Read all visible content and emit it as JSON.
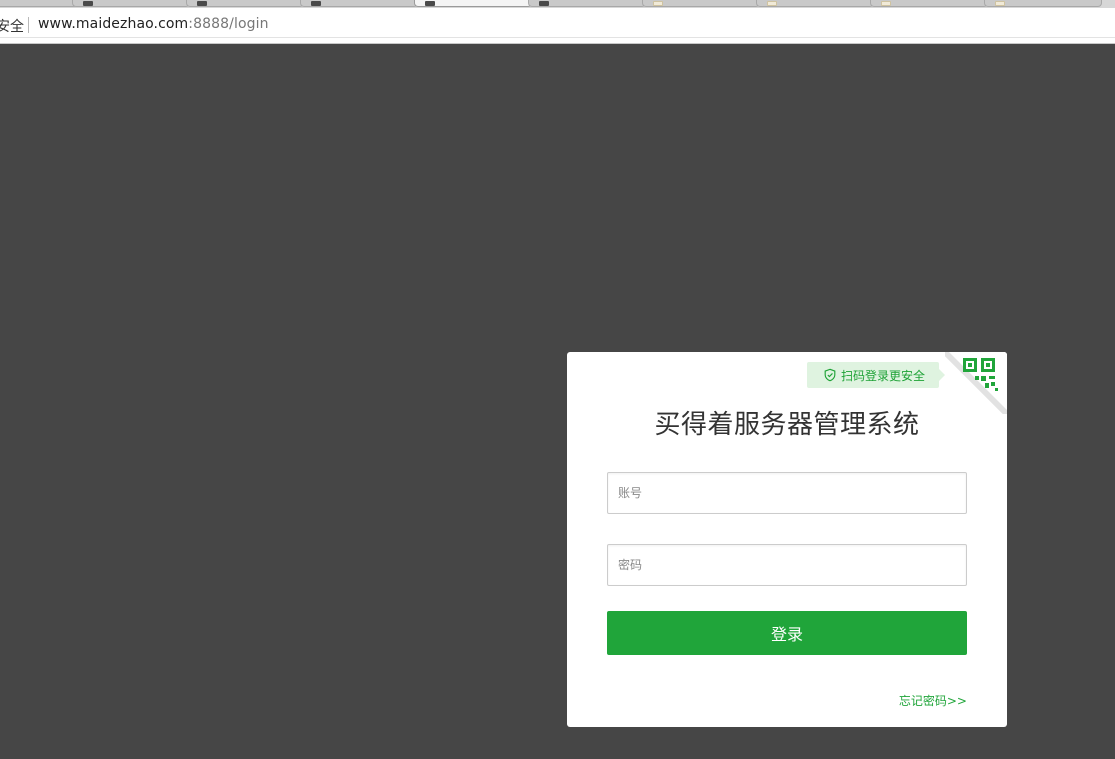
{
  "browser": {
    "security_label": "安全",
    "url_host": "www.maidezhao.com",
    "url_rest": ":8888/login"
  },
  "login": {
    "scan_tip": "扫码登录更安全",
    "title": "买得着服务器管理系统",
    "account_placeholder": "账号",
    "password_placeholder": "密码",
    "submit_label": "登录",
    "forgot_label": "忘记密码>>"
  },
  "colors": {
    "page_bg": "#464646",
    "accent": "#20a53a",
    "tip_bg": "#dff3e0"
  },
  "icons": [
    "shield-check-icon",
    "qr-code-icon",
    "favicon-icon"
  ]
}
